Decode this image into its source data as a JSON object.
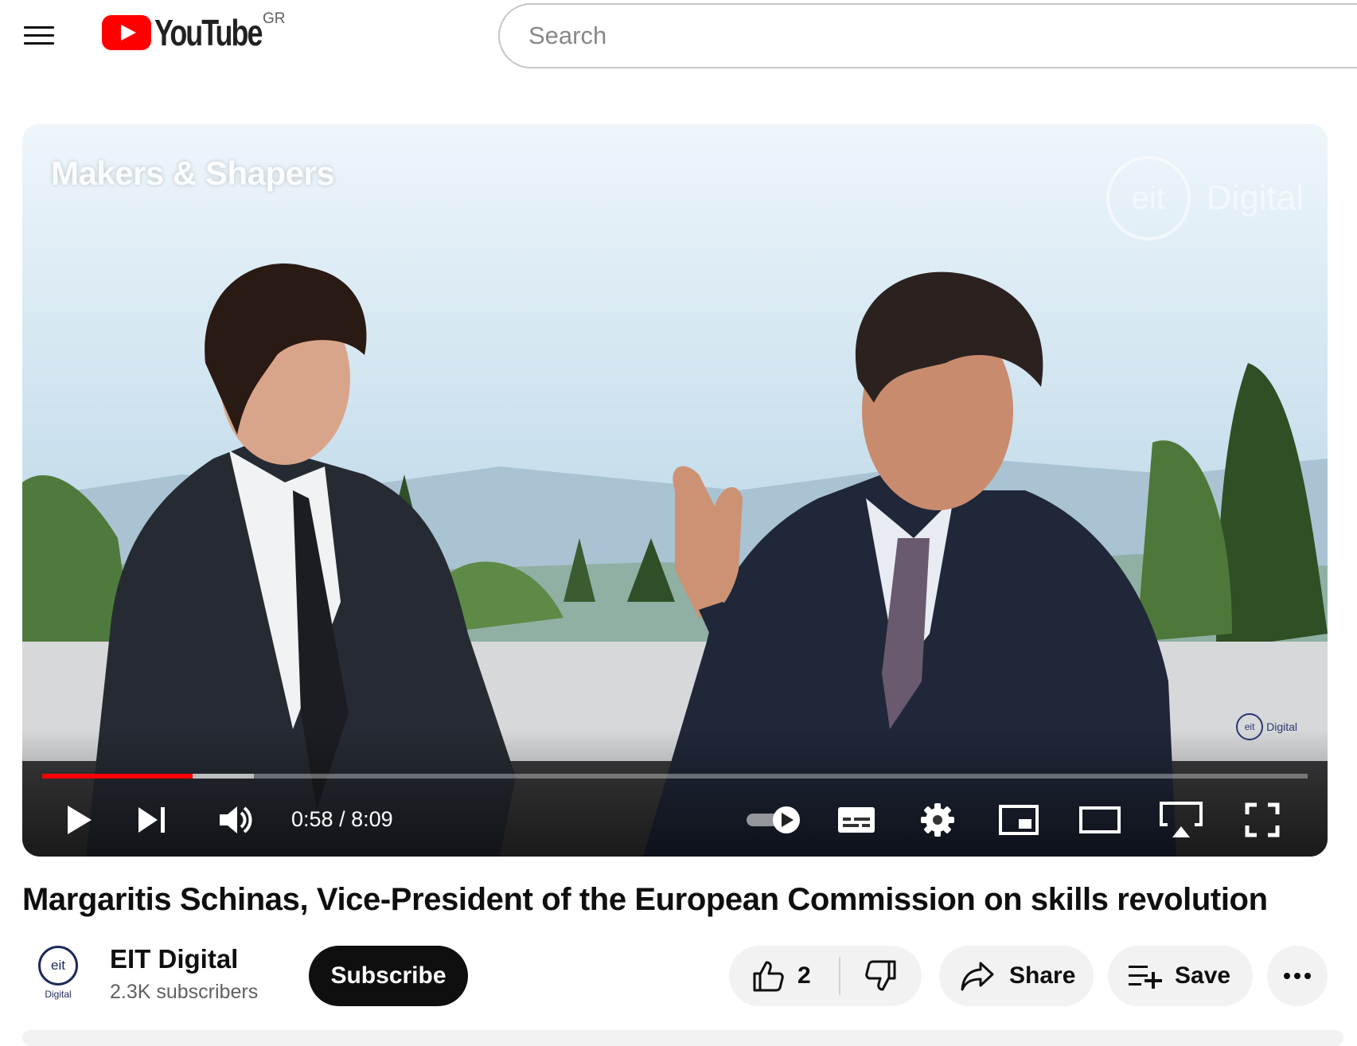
{
  "header": {
    "logo_text": "YouTube",
    "country_code": "GR",
    "search_placeholder": "Search"
  },
  "player": {
    "overlay_title": "Makers & Shapers",
    "watermark_logo": "eit",
    "watermark_text": "Digital",
    "corner_logo_text": "Digital",
    "current_time": "0:58",
    "time_separator": " / ",
    "duration": "8:09",
    "progress_fraction": 0.119,
    "buffered_fraction": 0.167,
    "controls": [
      "play-icon",
      "next-icon",
      "volume-icon",
      "autoplay-toggle-icon",
      "captions-icon",
      "settings-icon",
      "miniplayer-icon",
      "theater-icon",
      "cast-icon",
      "fullscreen-icon"
    ],
    "progress_color": "#ff0000"
  },
  "video": {
    "title": "Margaritis Schinas, Vice-President of the European Commission on skills revolution"
  },
  "channel": {
    "avatar_logo": "eit",
    "avatar_label": "Digital",
    "name": "EIT Digital",
    "subscribers": "2.3K subscribers",
    "subscribe_label": "Subscribe"
  },
  "actions": {
    "like_count": "2",
    "share_label": "Share",
    "save_label": "Save"
  }
}
